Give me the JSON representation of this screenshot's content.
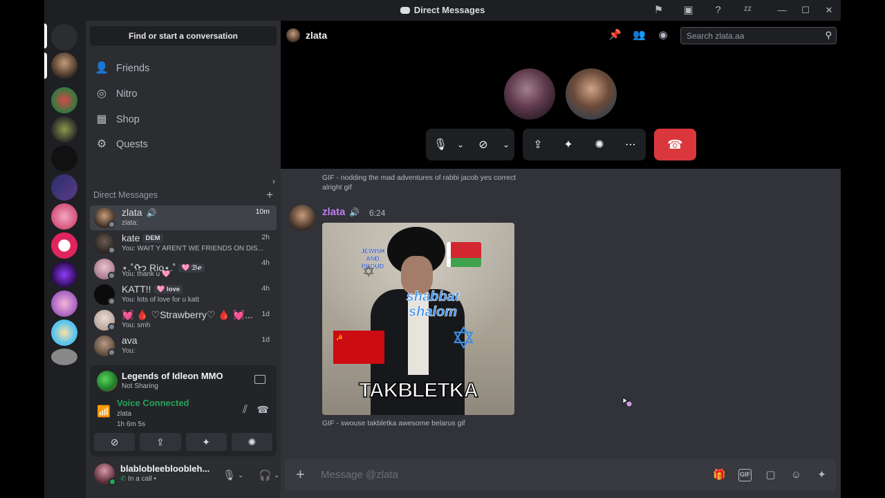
{
  "window": {
    "title": "Direct Messages",
    "controls": [
      "minimize",
      "maximize",
      "close"
    ]
  },
  "sidebar": {
    "find_placeholder": "Find or start a conversation",
    "nav": [
      {
        "label": "Friends",
        "icon": "friends-icon"
      },
      {
        "label": "Nitro",
        "icon": "nitro-icon"
      },
      {
        "label": "Shop",
        "icon": "shop-icon"
      },
      {
        "label": "Quests",
        "icon": "quests-icon"
      }
    ],
    "dm_header": "Direct Messages",
    "dms": [
      {
        "name": "zlata",
        "sub": "zlata:",
        "time": "10m",
        "tag": ""
      },
      {
        "name": "kate",
        "sub": "You: WAIT Y AREN'T WE FRIENDS ON DIS...",
        "time": "2h",
        "tag": "DEM"
      },
      {
        "name": "⋆.˚ᡣ𐭩 Rio⋆.˚",
        "sub": "You: thank u 🩷",
        "time": "4h",
        "tag": "🩷 ℬℯ"
      },
      {
        "name": "KATT!!",
        "sub": "You: lots of love for u katt",
        "time": "4h",
        "tag": "🩷 love"
      },
      {
        "name": "💓 🩸 ♡Strawberry♡ 🩸 💓...",
        "sub": "You: smh",
        "time": "1d",
        "tag": ""
      },
      {
        "name": "ava",
        "sub": "You:",
        "time": "1d",
        "tag": ""
      }
    ]
  },
  "activity": {
    "game": "Legends of Idleon MMO",
    "game_status": "Not Sharing",
    "voice_status": "Voice Connected",
    "voice_channel": "zlata",
    "voice_duration": "1h 6m 5s"
  },
  "user": {
    "name": "blablobleebloobleh...",
    "status": "In a call •"
  },
  "main": {
    "channel_name": "zlata",
    "search_placeholder": "Search zlata.aa",
    "previous_caption": "GIF - nodding the mad adventures of rabbi jacob yes correct alright gif",
    "message": {
      "author": "zlata",
      "time": "6:24",
      "gif_caption": "GIF - swouse takbletka awesome belarus gif",
      "gif_text_top": "JEWISH AND PROUD",
      "gif_text_mid": "shabbat shalom",
      "gif_text_bottom": "TAKBLETKA"
    },
    "composer_placeholder": "Message @zlata"
  }
}
